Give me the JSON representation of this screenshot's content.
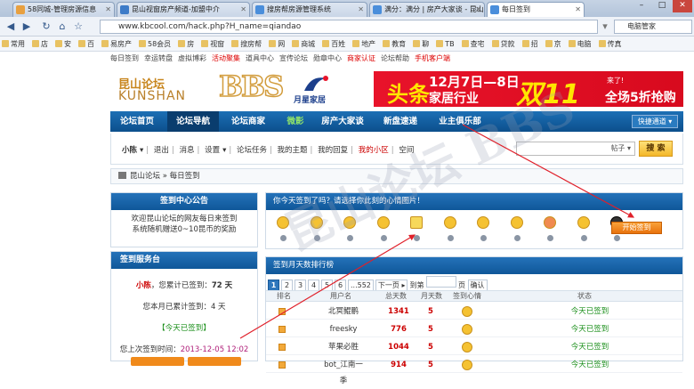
{
  "browser": {
    "tabs": [
      {
        "label": "58同城-管理房源信息"
      },
      {
        "label": "昆山视窗房产频道-加盟中介"
      },
      {
        "label": "搜房帮房源管理系统"
      },
      {
        "label": "满分：满分 | 房产大家谈 - 昆山论坛"
      },
      {
        "label": "每日签到"
      }
    ],
    "url": "www.kbcool.com/hack.php?H_name=qiandao",
    "search_label": "电脑管家",
    "bookmarks": [
      "常用",
      "店",
      "安",
      "百",
      "易房产",
      "58会员",
      "房",
      "视窗",
      "搜房帮",
      "网",
      "商城",
      "百姓",
      "地产",
      "教育",
      "聊",
      "TB",
      "查宅",
      "贷款",
      "招",
      "京",
      "电脑",
      "传真"
    ]
  },
  "top_links": [
    {
      "text": "每日签到",
      "red": false
    },
    {
      "text": "幸运转盘",
      "red": false
    },
    {
      "text": "虚拟博彩",
      "red": false
    },
    {
      "text": "活动聚集",
      "red": true
    },
    {
      "text": "道具中心",
      "red": false
    },
    {
      "text": "宣传论坛",
      "red": false
    },
    {
      "text": "勋章中心",
      "red": false
    },
    {
      "text": "商家认证",
      "red": true
    },
    {
      "text": "论坛帮助",
      "red": false
    },
    {
      "text": "手机客户端",
      "red": true
    }
  ],
  "logo": {
    "cn": "昆山论坛",
    "en": "KUNSHAN",
    "bbs": "BBS"
  },
  "ad": {
    "brand": "月星家居",
    "headline": "头条",
    "date": "12月7日—8日",
    "sub": "家居行业",
    "big": "双11",
    "promo": "来了!",
    "promo2": "全场5折抢购"
  },
  "nav": {
    "items": [
      "论坛首页",
      "论坛导航",
      "论坛商家",
      "微影",
      "房产大家谈",
      "新盘速递",
      "业主俱乐部"
    ],
    "quick": "快捷通道"
  },
  "userbar": {
    "username": "小陈",
    "links": [
      "退出",
      "消息",
      "设置",
      "论坛任务",
      "我的主题",
      "我的回复",
      "我的小区",
      "空间"
    ],
    "search_type": "帖子",
    "search_button": "搜 索"
  },
  "breadcrumb": {
    "home": "昆山论坛",
    "current": "每日签到"
  },
  "notice": {
    "title": "签到中心公告",
    "line1": "欢迎昆山论坛的网友每日来签到",
    "line2": "系统随机赠送0~10昆币的奖励"
  },
  "service": {
    "title": "签到服务台",
    "user": "小陈",
    "total_label": "，您累计已签到：",
    "total_value": "72 天",
    "month_text": "您本月已累计签到：4 天",
    "today_text": "【今天已签到】",
    "last_label": "您上次签到时间：",
    "last_time": "2013-12-05 12:02"
  },
  "mood": {
    "title": "你今天签到了吗？请选择你此刻的心情图片！",
    "start_button": "开始签到"
  },
  "ranking": {
    "title": "签到月天数排行榜",
    "pages": [
      "1",
      "2",
      "3",
      "4",
      "5",
      "6",
      "...552"
    ],
    "next": "下一页",
    "goto": "到第",
    "page_unit": "页",
    "confirm": "确认",
    "headers": [
      "排名",
      "用户名",
      "总天数",
      "月天数",
      "签到心情",
      "状态"
    ],
    "rows": [
      {
        "user": "北冥鲲鹏",
        "total": "1341",
        "month": "5",
        "status": "今天已签到"
      },
      {
        "user": "freesky",
        "total": "776",
        "month": "5",
        "status": "今天已签到"
      },
      {
        "user": "苹果必胜",
        "total": "1044",
        "month": "5",
        "status": "今天已签到"
      },
      {
        "user": "bot_江南一季",
        "total": "914",
        "month": "5",
        "status": "今天已签到"
      }
    ]
  },
  "watermark": "昆山论坛 BBS"
}
